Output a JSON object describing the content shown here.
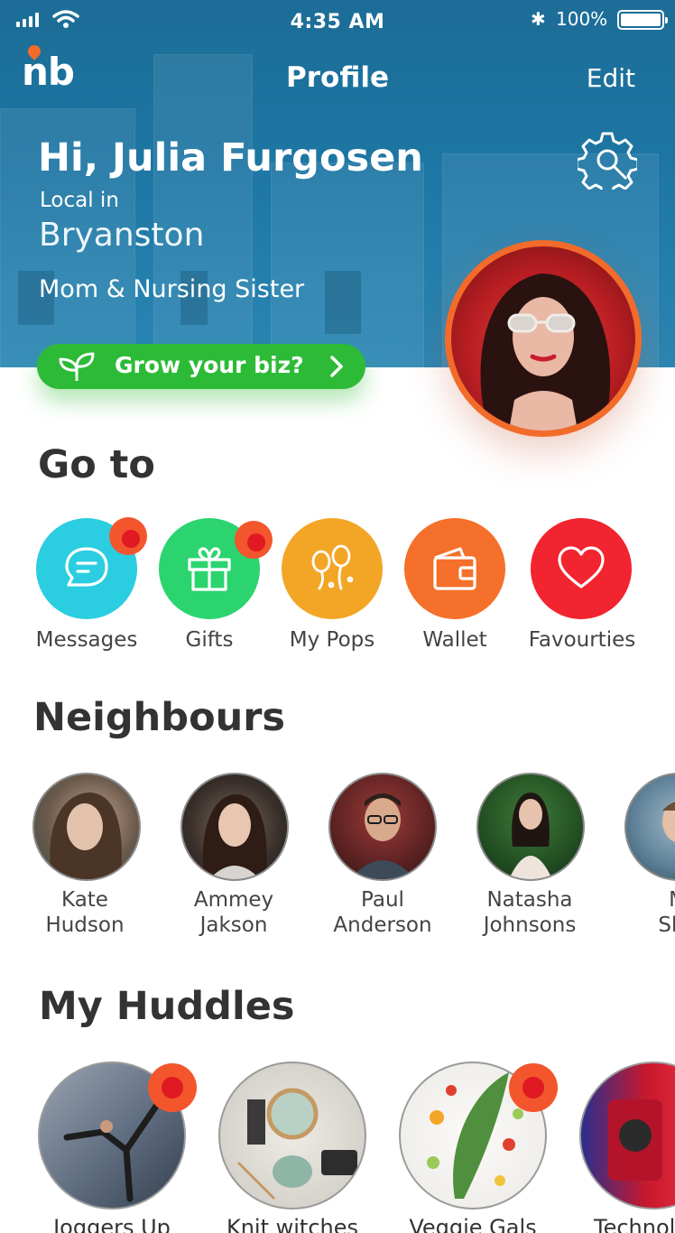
{
  "status": {
    "time": "4:35 AM",
    "battery": "100%"
  },
  "nav": {
    "title": "Profile",
    "edit": "Edit",
    "logo": "nb"
  },
  "profile": {
    "greeting": "Hi, Julia Furgosen",
    "local_in": "Local in",
    "city": "Bryanston",
    "role": "Mom & Nursing Sister",
    "cta": "Grow your biz?"
  },
  "goto": {
    "title": "Go to",
    "items": [
      {
        "label": "Messages",
        "icon": "message-icon",
        "color": "#2bcde0",
        "badge": true
      },
      {
        "label": "Gifts",
        "icon": "gift-icon",
        "color": "#2bd46f",
        "badge": true
      },
      {
        "label": "My Pops",
        "icon": "balloons-icon",
        "color": "#f3a626",
        "badge": false
      },
      {
        "label": "Wallet",
        "icon": "wallet-icon",
        "color": "#f5702a",
        "badge": false
      },
      {
        "label": "Favourties",
        "icon": "heart-icon",
        "color": "#f2242f",
        "badge": false
      }
    ]
  },
  "neighbours": {
    "title": "Neighbours",
    "items": [
      {
        "first": "Kate",
        "last": "Hudson"
      },
      {
        "first": "Ammey",
        "last": "Jakson"
      },
      {
        "first": "Paul",
        "last": "Anderson"
      },
      {
        "first": "Natasha",
        "last": "Johnsons"
      },
      {
        "first": "M",
        "last": "Sha"
      }
    ]
  },
  "huddles": {
    "title": "My Huddles",
    "items": [
      {
        "label": "Joggers Up",
        "badge": true
      },
      {
        "label": "Knit witches",
        "badge": false
      },
      {
        "label": "Veggie Gals",
        "badge": true
      },
      {
        "label": "Technol",
        "badge": false
      }
    ]
  },
  "colors": {
    "brand_orange": "#f26b2a",
    "cta_green": "#2dbb37",
    "header_blue": "#1d76a3",
    "badge_red": "#e01922"
  }
}
